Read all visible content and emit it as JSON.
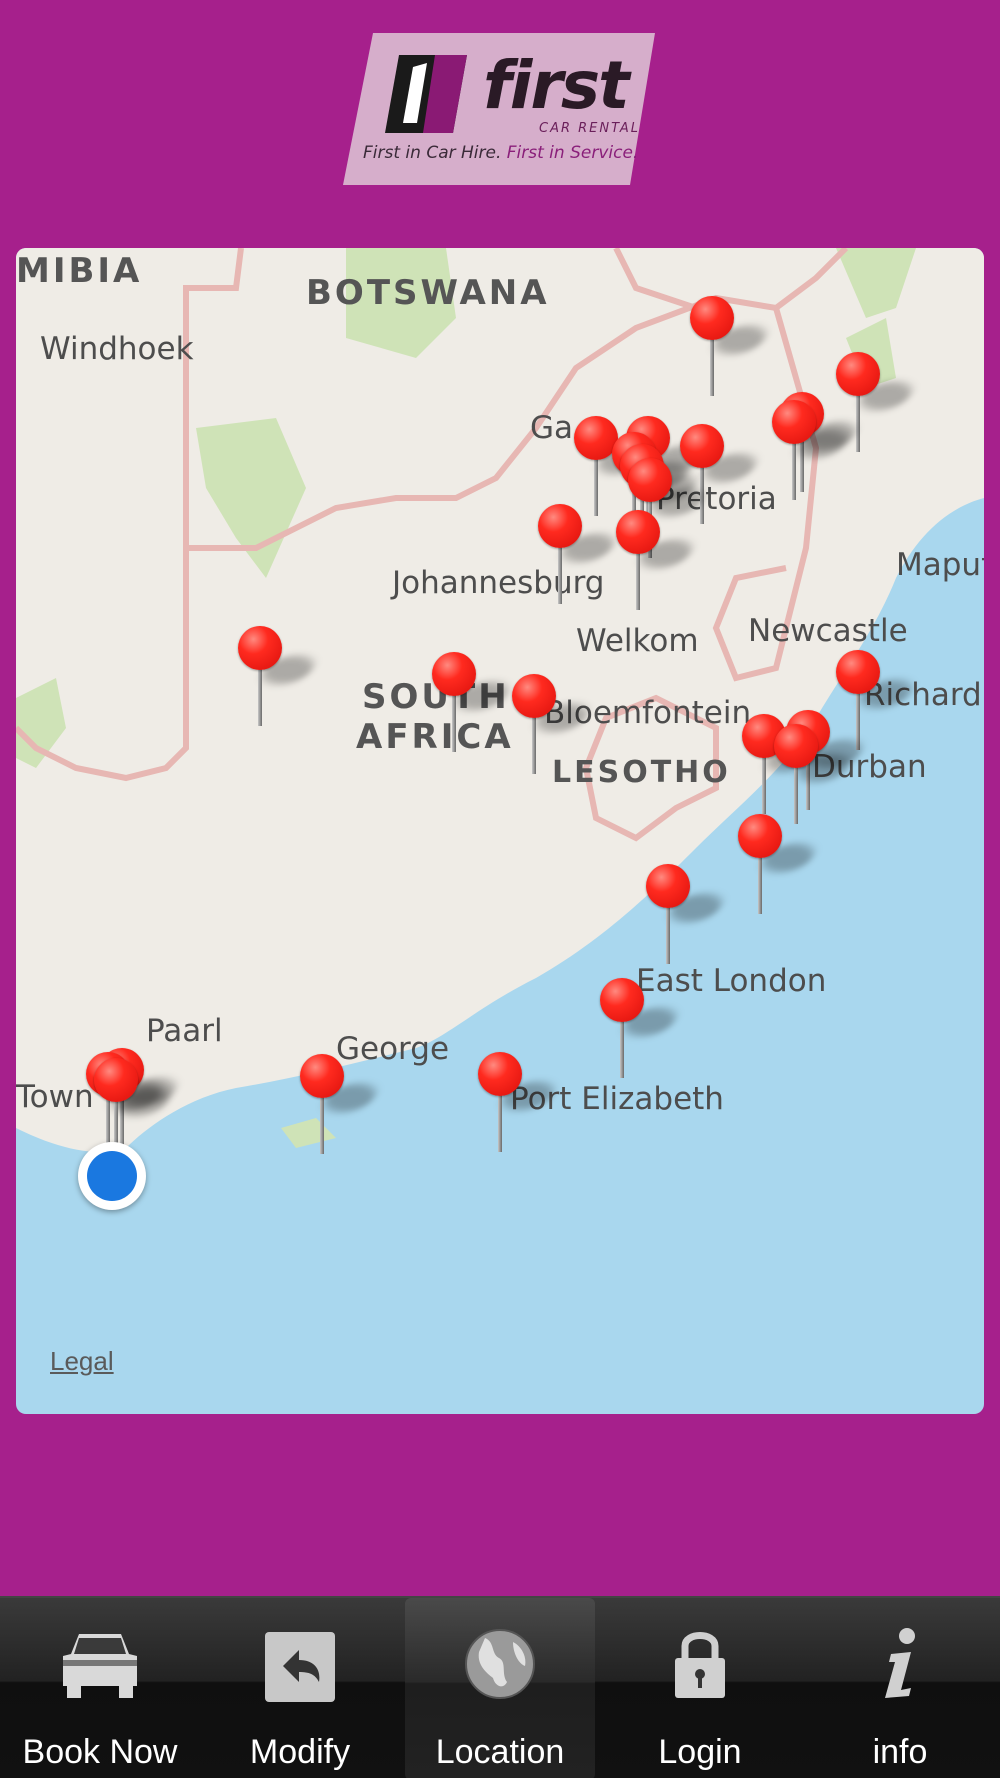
{
  "logo": {
    "word": "first",
    "subtitle": "CAR RENTAL",
    "tagline_part1": "First in Car Hire.",
    "tagline_part2": "First in Service.",
    "brand_purple": "#a6208c"
  },
  "map": {
    "countries": [
      "MIBIA",
      "BOTSWANA",
      "SOUTH",
      "AFRICA",
      "LESOTHO"
    ],
    "cities": [
      "Windhoek",
      "Ga",
      "Pretoria",
      "Johannesburg",
      "Welkom",
      "Newcastle",
      "Maput",
      "Richard",
      "Bloemfontein",
      "Durban",
      "East London",
      "Paarl",
      "George",
      "Port Elizabeth",
      "Town"
    ],
    "legal": "Legal",
    "pin_color": "#ff2a1f",
    "user_location_color": "#1a78e0"
  },
  "tabs": [
    {
      "label": "Book Now",
      "icon": "car-icon"
    },
    {
      "label": "Modify",
      "icon": "reply-arrow-icon"
    },
    {
      "label": "Location",
      "icon": "globe-icon"
    },
    {
      "label": "Login",
      "icon": "padlock-icon"
    },
    {
      "label": "info",
      "icon": "info-icon"
    }
  ],
  "active_tab": "Location"
}
